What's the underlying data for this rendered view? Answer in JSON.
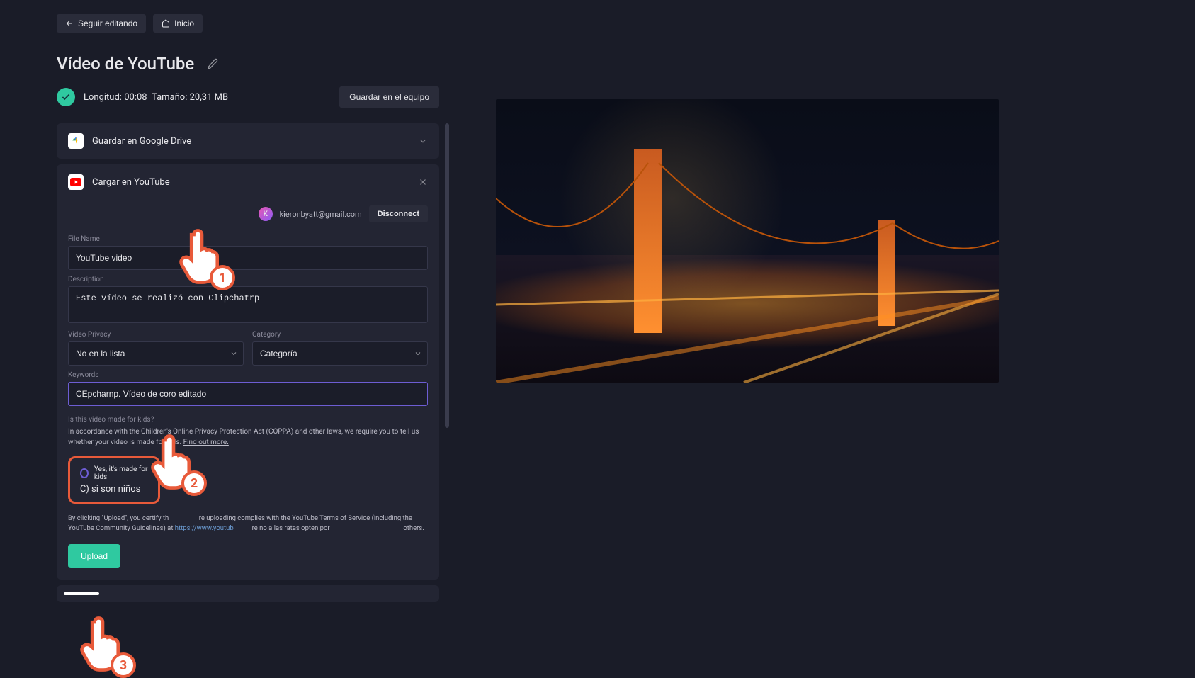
{
  "nav": {
    "back": "Seguir editando",
    "home": "Inicio"
  },
  "title": "Vídeo de YouTube",
  "meta": {
    "length_label": "Longitud:",
    "length": "00:08",
    "size_label": "Tamaño:",
    "size": "20,31 MB",
    "save": "Guardar en el equipo"
  },
  "gdrive": {
    "label": "Guardar en Google Drive"
  },
  "youtube": {
    "label": "Cargar en YouTube",
    "acct_initial": "K",
    "email": "kieronbyatt@gmail.com",
    "disconnect": "Disconnect",
    "file_name_label": "File Name",
    "file_name": "YouTube video",
    "desc_label": "Description",
    "desc": "Este vídeo se realizó con Clipchatrp",
    "privacy_label": "Video Privacy",
    "privacy_value": "No en la lista",
    "category_label": "Category",
    "category_value": "Categoría",
    "keywords_label": "Keywords",
    "keywords": "CEpcharnp. Vídeo de coro editado",
    "kids_q": "Is this video made for kids?",
    "kids_info": "In accordance with the Children's Online Privacy Protection Act (COPPA) and other laws, we require you to tell us whether your video is made for kids. ",
    "kids_link": "Find out more.",
    "radio_label": "Yes, it's made for kids",
    "radio_sub": "C) si son niños",
    "terms_p1": "By clicking \"Upload\", you certify th",
    "terms_p2": "re uploading complies with the YouTube Terms of Service (including the YouTube Community Guidelines) at ",
    "terms_link": "https://www.youtub",
    "terms_p3": "re no a las ratas opten por",
    "terms_p4": "others.",
    "upload": "Upload"
  },
  "annotations": {
    "n1": "1",
    "n2": "2",
    "n3": "3"
  }
}
